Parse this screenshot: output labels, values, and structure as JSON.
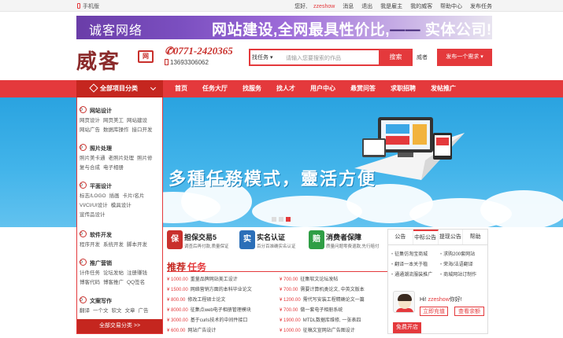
{
  "topbar": {
    "mobile": "手机版",
    "links": [
      "消息",
      "退出",
      "我是雇主",
      "我的威客",
      "帮助中心",
      "发布任务"
    ],
    "user": "zzeshow",
    "user_prefix": "您好,"
  },
  "banner": {
    "left": "诚客网络",
    "right_main": "网站建设,全网最具性价比,",
    "right_sep": "——",
    "right_tail": "实体公司!"
  },
  "header": {
    "logo": "威客",
    "seal": "网",
    "phone": "0771-2420365",
    "mobile": "13693306062"
  },
  "search": {
    "scope": "找任务",
    "placeholder": "请输入您要搜索的作品",
    "button": "搜索",
    "hire": "威者",
    "post": "发布一个需求"
  },
  "nav": {
    "category": "全部项目分类",
    "items": [
      "首页",
      "任务大厅",
      "找服务",
      "找人才",
      "用户中心",
      "悬赏问答",
      "求职招聘",
      "发帖推广"
    ]
  },
  "hero": {
    "slogan": "多種任務模式，靈活方便"
  },
  "categories": [
    {
      "title": "网站设计",
      "subs": [
        "网页设计",
        "网页美工",
        "网站建设",
        "网站广告",
        "数据库操作",
        "接口开发"
      ]
    },
    {
      "title": "照片处理",
      "subs": [
        "照片美卡通",
        "老照片处理",
        "照片修",
        "复与合成",
        "电子相册"
      ]
    },
    {
      "title": "平面设计",
      "subs": [
        "标志/LOGO",
        "插画",
        "卡片/名片",
        "VI/CI/UI设计",
        "模具设计",
        "宣传品设计"
      ]
    },
    {
      "title": "软件开发",
      "subs": [
        "程序开发",
        "系统开发",
        "脚本开发"
      ]
    },
    {
      "title": "推广营销",
      "subs": [
        "计件任务",
        "论坛发帖",
        "注册赚钱",
        "博客代码",
        "博客推广",
        "QQ签名"
      ]
    },
    {
      "title": "文案写作",
      "subs": [
        "翻译",
        "一个文",
        "软文",
        "文章",
        "广告"
      ]
    }
  ],
  "all_categories": "全部交易分类 >>",
  "features": [
    {
      "icon": "保",
      "title": "担保交易5",
      "sub": "调查后再付款,质量保证"
    },
    {
      "icon": "实",
      "title": "实名认证",
      "sub": "百分百准确实名认证"
    },
    {
      "icon": "赔",
      "title": "消费者保障",
      "sub": "质量问题零费退款,先行赔付"
    }
  ],
  "tasks": {
    "title_a": "推荐",
    "title_b": "任务",
    "left": [
      {
        "price": "¥ 1000.00",
        "name": "重量品牌网站美工设计"
      },
      {
        "price": "¥ 1500.00",
        "name": "网络营销方面的本科毕业论文"
      },
      {
        "price": "¥ 800.00",
        "name": "修改工程硕士论文"
      },
      {
        "price": "¥ 8000.00",
        "name": "征集点web电子相册管理模块"
      },
      {
        "price": "¥ 3000.00",
        "name": "基于curls技术的中间件接口"
      },
      {
        "price": "¥ 600.00",
        "name": "网站广告设计"
      }
    ],
    "right": [
      {
        "price": "¥ 700.00",
        "name": "征集软文论坛发帖"
      },
      {
        "price": "¥ 700.00",
        "name": "需要计算机类论文, 中英文版本"
      },
      {
        "price": "¥ 1200.00",
        "name": "需代写安装工程精确论文一篇"
      },
      {
        "price": "¥ 700.00",
        "name": "做一套电子相册系统"
      },
      {
        "price": "¥ 1900.00",
        "name": "MTDL数据库维修, 一张表四"
      },
      {
        "price": "¥ 1000.00",
        "name": "征稿文宣网站广告图设计"
      }
    ]
  },
  "notice": {
    "tabs": [
      "公告",
      "中标公告",
      "提现公告",
      "帮助"
    ],
    "items": [
      "征集仿淘宝商城",
      "求购200套网站",
      "翻译一本关于植",
      "荣海/法语翻译",
      "通通潮流服装推广",
      "商城网站订制作"
    ],
    "greet_prefix": "Hi!",
    "username": "zzeshow",
    "greet_suffix": "你好!",
    "recharge": "立即充值",
    "balance": "查看余额",
    "open": "免费开店"
  }
}
